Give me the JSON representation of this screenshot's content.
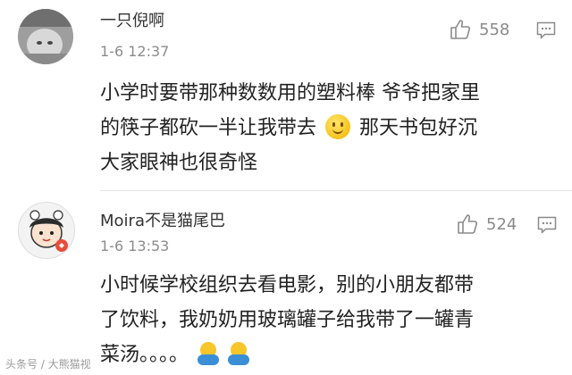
{
  "comments": [
    {
      "username": "一只倪啊",
      "timestamp": "1-6 12:37",
      "likes": "558",
      "body_lines": [
        "小学时要带那种数数用的塑料棒 爷爷把家里",
        "的筷子都砍一半让我带去",
        "那天书包好沉",
        "大家眼神也很奇怪"
      ],
      "emoji": "smile-emoji"
    },
    {
      "username": "Moira不是猫尾巴",
      "timestamp": "1-6 13:53",
      "likes": "524",
      "body_lines": [
        "小时候学校组织去看电影，别的小朋友都带",
        "了饮料，我奶奶用玻璃罐子给我带了一罐青",
        "菜汤。。。。"
      ],
      "emoji": "hug-emoji"
    }
  ],
  "icons": {
    "like": "thumbs-up-icon",
    "reply": "comment-bubble-icon"
  },
  "watermark": "头条号 / 大熊猫视"
}
